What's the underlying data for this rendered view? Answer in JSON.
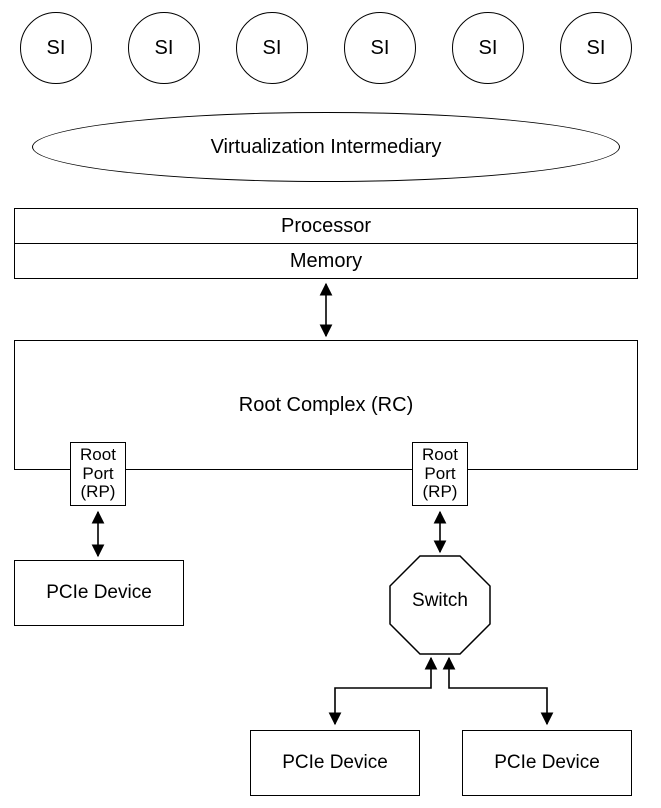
{
  "si": {
    "labels": [
      "SI",
      "SI",
      "SI",
      "SI",
      "SI",
      "SI"
    ]
  },
  "vi": {
    "label": "Virtualization Intermediary"
  },
  "cpu_block": {
    "processor": "Processor",
    "memory": "Memory"
  },
  "root_complex": {
    "label": "Root Complex (RC)"
  },
  "root_ports": {
    "left": {
      "line1": "Root",
      "line2": "Port",
      "line3": "(RP)"
    },
    "right": {
      "line1": "Root",
      "line2": "Port",
      "line3": "(RP)"
    }
  },
  "pcie": {
    "left": "PCIe Device",
    "bottom_left": "PCIe Device",
    "bottom_right": "PCIe Device"
  },
  "switch": {
    "label": "Switch"
  }
}
